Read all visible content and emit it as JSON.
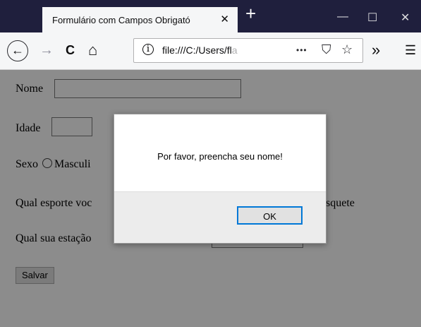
{
  "browser": {
    "tab_title": "Formulário com Campos Obrigató",
    "tab_close": "✕",
    "new_tab": "+",
    "win_minimize": "—",
    "win_maximize": "☐",
    "win_close": "✕",
    "nav": {
      "back": "←",
      "forward": "→",
      "reload": "C",
      "home": "⌂"
    },
    "url_info": "i",
    "url_visible": "file:///C:/Users/fl",
    "url_faded": "a",
    "url_more": "•••",
    "pocket": "⛉",
    "bookmark": "☆",
    "overflow": "»",
    "menu": "☰"
  },
  "form": {
    "nome_label": "Nome",
    "idade_label": "Idade",
    "sexo_label": "Sexo",
    "sexo_option_visible": "Masculi",
    "esporte_label_visible": "Qual esporte voc",
    "esporte_option_visible": "squete",
    "estacao_label_visible": "Qual sua estação",
    "salvar_button": "Salvar"
  },
  "dialog": {
    "message": "Por favor, preencha seu nome!",
    "ok_button": "OK"
  }
}
